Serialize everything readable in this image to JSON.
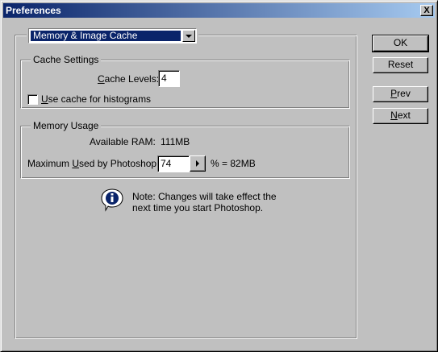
{
  "window": {
    "title": "Preferences",
    "close_label": "X"
  },
  "category": {
    "selected": "Memory & Image Cache"
  },
  "cache_settings": {
    "group_label": "Cache Settings",
    "cache_levels_prefix": "",
    "cache_levels_access": "C",
    "cache_levels_rest": "ache Levels:",
    "cache_levels_value": "4",
    "histogram_access": "U",
    "histogram_rest": "se cache for histograms",
    "histogram_checked": false
  },
  "memory_usage": {
    "group_label": "Memory Usage",
    "available_ram_label": "Available RAM:",
    "available_ram_value": "111MB",
    "max_used_prefix": "Maximum ",
    "max_used_access": "U",
    "max_used_rest": "sed by Photoshop:",
    "max_used_value": "74",
    "percent_text": "% = 82MB"
  },
  "note": {
    "line1": "Note: Changes will take effect the",
    "line2": "next time you start Photoshop.",
    "icon": "info-icon"
  },
  "buttons": {
    "ok": "OK",
    "reset": "Reset",
    "prev_access": "P",
    "prev_rest": "rev",
    "next_access": "N",
    "next_rest": "ext"
  }
}
